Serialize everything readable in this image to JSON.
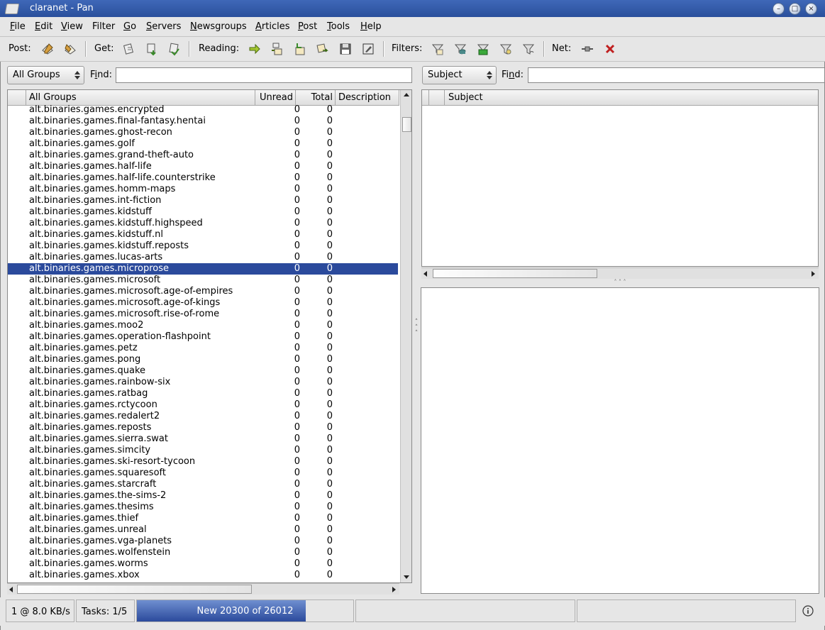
{
  "window": {
    "title": "claranet - Pan"
  },
  "menu": [
    {
      "label": "File",
      "u": "F",
      "rest": "ile"
    },
    {
      "label": "Edit",
      "u": "E",
      "rest": "dit"
    },
    {
      "label": "View",
      "u": "V",
      "rest": "iew"
    },
    {
      "label": "Filter",
      "u": "F",
      "rest": "ilter",
      "pre": ""
    },
    {
      "label": "Go",
      "u": "G",
      "rest": "o"
    },
    {
      "label": "Servers",
      "u": "S",
      "rest": "ervers"
    },
    {
      "label": "Newsgroups",
      "u": "N",
      "rest": "ewsgroups"
    },
    {
      "label": "Articles",
      "u": "A",
      "rest": "rticles"
    },
    {
      "label": "Post",
      "u": "P",
      "rest": "ost"
    },
    {
      "label": "Tools",
      "u": "T",
      "rest": "ools"
    },
    {
      "label": "Help",
      "u": "H",
      "rest": "elp"
    }
  ],
  "toolbar": {
    "post_label": "Post:",
    "get_label": "Get:",
    "reading_label": "Reading:",
    "filters_label": "Filters:",
    "net_label": "Net:"
  },
  "group_pane": {
    "filter_combo": "All Groups",
    "find_label": "Find:",
    "find_value": "",
    "columns": {
      "name": "All Groups",
      "unread": "Unread",
      "total": "Total",
      "description": "Description"
    },
    "selected_group": "alt.binaries.games.microprose",
    "groups": [
      {
        "name": "alt.binaries.games.encrypted",
        "unread": "0",
        "total": "0"
      },
      {
        "name": "alt.binaries.games.final-fantasy.hentai",
        "unread": "0",
        "total": "0"
      },
      {
        "name": "alt.binaries.games.ghost-recon",
        "unread": "0",
        "total": "0"
      },
      {
        "name": "alt.binaries.games.golf",
        "unread": "0",
        "total": "0"
      },
      {
        "name": "alt.binaries.games.grand-theft-auto",
        "unread": "0",
        "total": "0"
      },
      {
        "name": "alt.binaries.games.half-life",
        "unread": "0",
        "total": "0"
      },
      {
        "name": "alt.binaries.games.half-life.counterstrike",
        "unread": "0",
        "total": "0"
      },
      {
        "name": "alt.binaries.games.homm-maps",
        "unread": "0",
        "total": "0"
      },
      {
        "name": "alt.binaries.games.int-fiction",
        "unread": "0",
        "total": "0"
      },
      {
        "name": "alt.binaries.games.kidstuff",
        "unread": "0",
        "total": "0"
      },
      {
        "name": "alt.binaries.games.kidstuff.highspeed",
        "unread": "0",
        "total": "0"
      },
      {
        "name": "alt.binaries.games.kidstuff.nl",
        "unread": "0",
        "total": "0"
      },
      {
        "name": "alt.binaries.games.kidstuff.reposts",
        "unread": "0",
        "total": "0"
      },
      {
        "name": "alt.binaries.games.lucas-arts",
        "unread": "0",
        "total": "0"
      },
      {
        "name": "alt.binaries.games.microprose",
        "unread": "0",
        "total": "0"
      },
      {
        "name": "alt.binaries.games.microsoft",
        "unread": "0",
        "total": "0"
      },
      {
        "name": "alt.binaries.games.microsoft.age-of-empires",
        "unread": "0",
        "total": "0"
      },
      {
        "name": "alt.binaries.games.microsoft.age-of-kings",
        "unread": "0",
        "total": "0"
      },
      {
        "name": "alt.binaries.games.microsoft.rise-of-rome",
        "unread": "0",
        "total": "0"
      },
      {
        "name": "alt.binaries.games.moo2",
        "unread": "0",
        "total": "0"
      },
      {
        "name": "alt.binaries.games.operation-flashpoint",
        "unread": "0",
        "total": "0"
      },
      {
        "name": "alt.binaries.games.petz",
        "unread": "0",
        "total": "0"
      },
      {
        "name": "alt.binaries.games.pong",
        "unread": "0",
        "total": "0"
      },
      {
        "name": "alt.binaries.games.quake",
        "unread": "0",
        "total": "0"
      },
      {
        "name": "alt.binaries.games.rainbow-six",
        "unread": "0",
        "total": "0"
      },
      {
        "name": "alt.binaries.games.ratbag",
        "unread": "0",
        "total": "0"
      },
      {
        "name": "alt.binaries.games.rctycoon",
        "unread": "0",
        "total": "0"
      },
      {
        "name": "alt.binaries.games.redalert2",
        "unread": "0",
        "total": "0"
      },
      {
        "name": "alt.binaries.games.reposts",
        "unread": "0",
        "total": "0"
      },
      {
        "name": "alt.binaries.games.sierra.swat",
        "unread": "0",
        "total": "0"
      },
      {
        "name": "alt.binaries.games.simcity",
        "unread": "0",
        "total": "0"
      },
      {
        "name": "alt.binaries.games.ski-resort-tycoon",
        "unread": "0",
        "total": "0"
      },
      {
        "name": "alt.binaries.games.squaresoft",
        "unread": "0",
        "total": "0"
      },
      {
        "name": "alt.binaries.games.starcraft",
        "unread": "0",
        "total": "0"
      },
      {
        "name": "alt.binaries.games.the-sims-2",
        "unread": "0",
        "total": "0"
      },
      {
        "name": "alt.binaries.games.thesims",
        "unread": "0",
        "total": "0"
      },
      {
        "name": "alt.binaries.games.thief",
        "unread": "0",
        "total": "0"
      },
      {
        "name": "alt.binaries.games.unreal",
        "unread": "0",
        "total": "0"
      },
      {
        "name": "alt.binaries.games.vga-planets",
        "unread": "0",
        "total": "0"
      },
      {
        "name": "alt.binaries.games.wolfenstein",
        "unread": "0",
        "total": "0"
      },
      {
        "name": "alt.binaries.games.worms",
        "unread": "0",
        "total": "0"
      },
      {
        "name": "alt.binaries.games.xbox",
        "unread": "0",
        "total": "0"
      }
    ]
  },
  "header_pane": {
    "filter_combo": "Subject",
    "find_label": "Find:",
    "find_value": "",
    "columns": {
      "subject": "Subject"
    }
  },
  "status": {
    "connections": "1 @ 8.0 KB/s",
    "tasks": "Tasks: 1/5",
    "progress_text": "New 20300 of 26012",
    "progress_fraction": 0.78
  },
  "colors": {
    "selection": "#2b4a9c",
    "titlebar": "#2a4f9c"
  },
  "icons": [
    "post-article-icon",
    "followup-icon",
    "get-headers-icon",
    "get-new-headers-icon",
    "get-subscribed-icon",
    "read-next-unread-icon",
    "read-next-thread-icon",
    "read-previous-icon",
    "read-next-article-icon",
    "save-icon",
    "edit-icon",
    "filter-icon",
    "filter-cache-icon",
    "filter-new-icon",
    "filter-watched-icon",
    "filter-ignored-icon",
    "net-connect-icon",
    "cancel-task-icon",
    "info-icon"
  ]
}
